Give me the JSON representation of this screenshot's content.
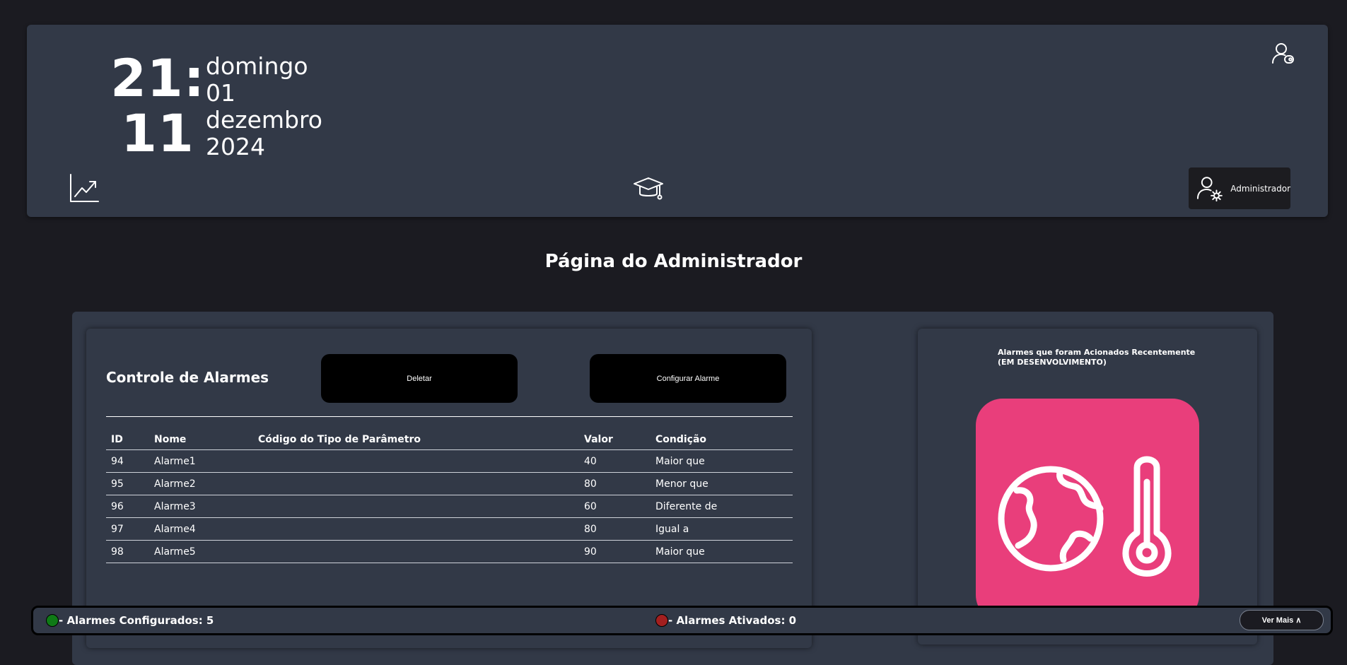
{
  "header": {
    "clock": {
      "hours": "21:",
      "minutes": "11"
    },
    "date": {
      "weekday": "domingo",
      "day": "01",
      "month": "dezembro",
      "year": "2024"
    },
    "admin_label": "Administrador"
  },
  "page_title": "Página do Administrador",
  "alarm_control": {
    "title": "Controle de Alarmes",
    "delete_label": "Deletar",
    "configure_label": "Configurar Alarme",
    "columns": [
      "ID",
      "Nome",
      "Código do Tipo de Parâmetro",
      "Valor",
      "Condição"
    ],
    "rows": [
      {
        "id": "94",
        "name": "Alarme1",
        "code": "",
        "value": "40",
        "condition": "Maior que"
      },
      {
        "id": "95",
        "name": "Alarme2",
        "code": "",
        "value": "80",
        "condition": "Menor que"
      },
      {
        "id": "96",
        "name": "Alarme3",
        "code": "",
        "value": "60",
        "condition": "Diferente de"
      },
      {
        "id": "97",
        "name": "Alarme4",
        "code": "",
        "value": "80",
        "condition": "Igual a"
      },
      {
        "id": "98",
        "name": "Alarme5",
        "code": "",
        "value": "90",
        "condition": "Maior que"
      }
    ]
  },
  "recent_alarms": {
    "title_line1": "Alarmes que foram Acionados Recentemente",
    "title_line2": "(EM DESENVOLVIMENTO)",
    "illustration_icon": "globe-thermometer-icon",
    "illustration_bg": "#e93e7b"
  },
  "footer": {
    "configured_label": "- Alarmes Configurados: 5",
    "activated_label": "- Alarmes Ativados: 0",
    "configured_color": "#0f7a16",
    "activated_color": "#a31f1f",
    "more_label": "Ver Mais ∧"
  },
  "icons": {
    "logout": "user-logout-icon",
    "charts": "trending-chart-icon",
    "education": "graduation-cap-icon",
    "admin": "user-settings-icon"
  }
}
